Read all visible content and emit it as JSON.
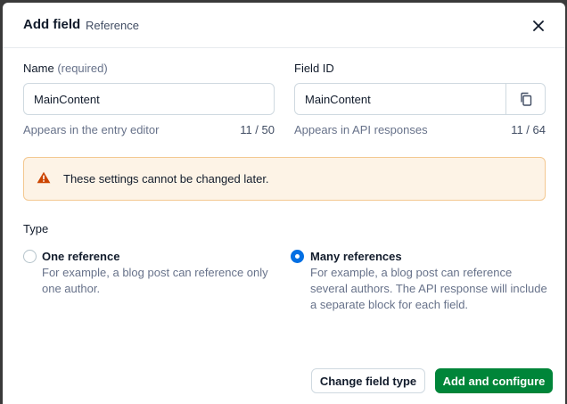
{
  "dialog": {
    "title": "Add field",
    "subtitle": "Reference"
  },
  "name_field": {
    "label": "Name",
    "required_text": "(required)",
    "value": "MainContent",
    "help": "Appears in the entry editor",
    "count": "11 / 50"
  },
  "id_field": {
    "label": "Field ID",
    "value": "MainContent",
    "help": "Appears in API responses",
    "count": "11 / 64"
  },
  "warning": {
    "text": "These settings cannot be changed later."
  },
  "type_section": {
    "title": "Type",
    "options": [
      {
        "label": "One reference",
        "desc_lines": [
          "For example, a blog post can reference only",
          "one author."
        ],
        "selected": false
      },
      {
        "label": "Many references",
        "desc_lines": [
          "For example, a blog post can reference",
          "several authors. The API response will include",
          "a separate block for each field."
        ],
        "selected": true
      }
    ]
  },
  "footer": {
    "secondary_label": "Change field type",
    "primary_label": "Add and configure"
  },
  "colors": {
    "accent": "#036fe3",
    "primary": "#008539",
    "warning_bg": "#fdf3e6",
    "warning_icon": "#cc4500"
  },
  "icons": {
    "close": "close-icon",
    "copy": "copy-icon",
    "warning": "warning-icon"
  }
}
